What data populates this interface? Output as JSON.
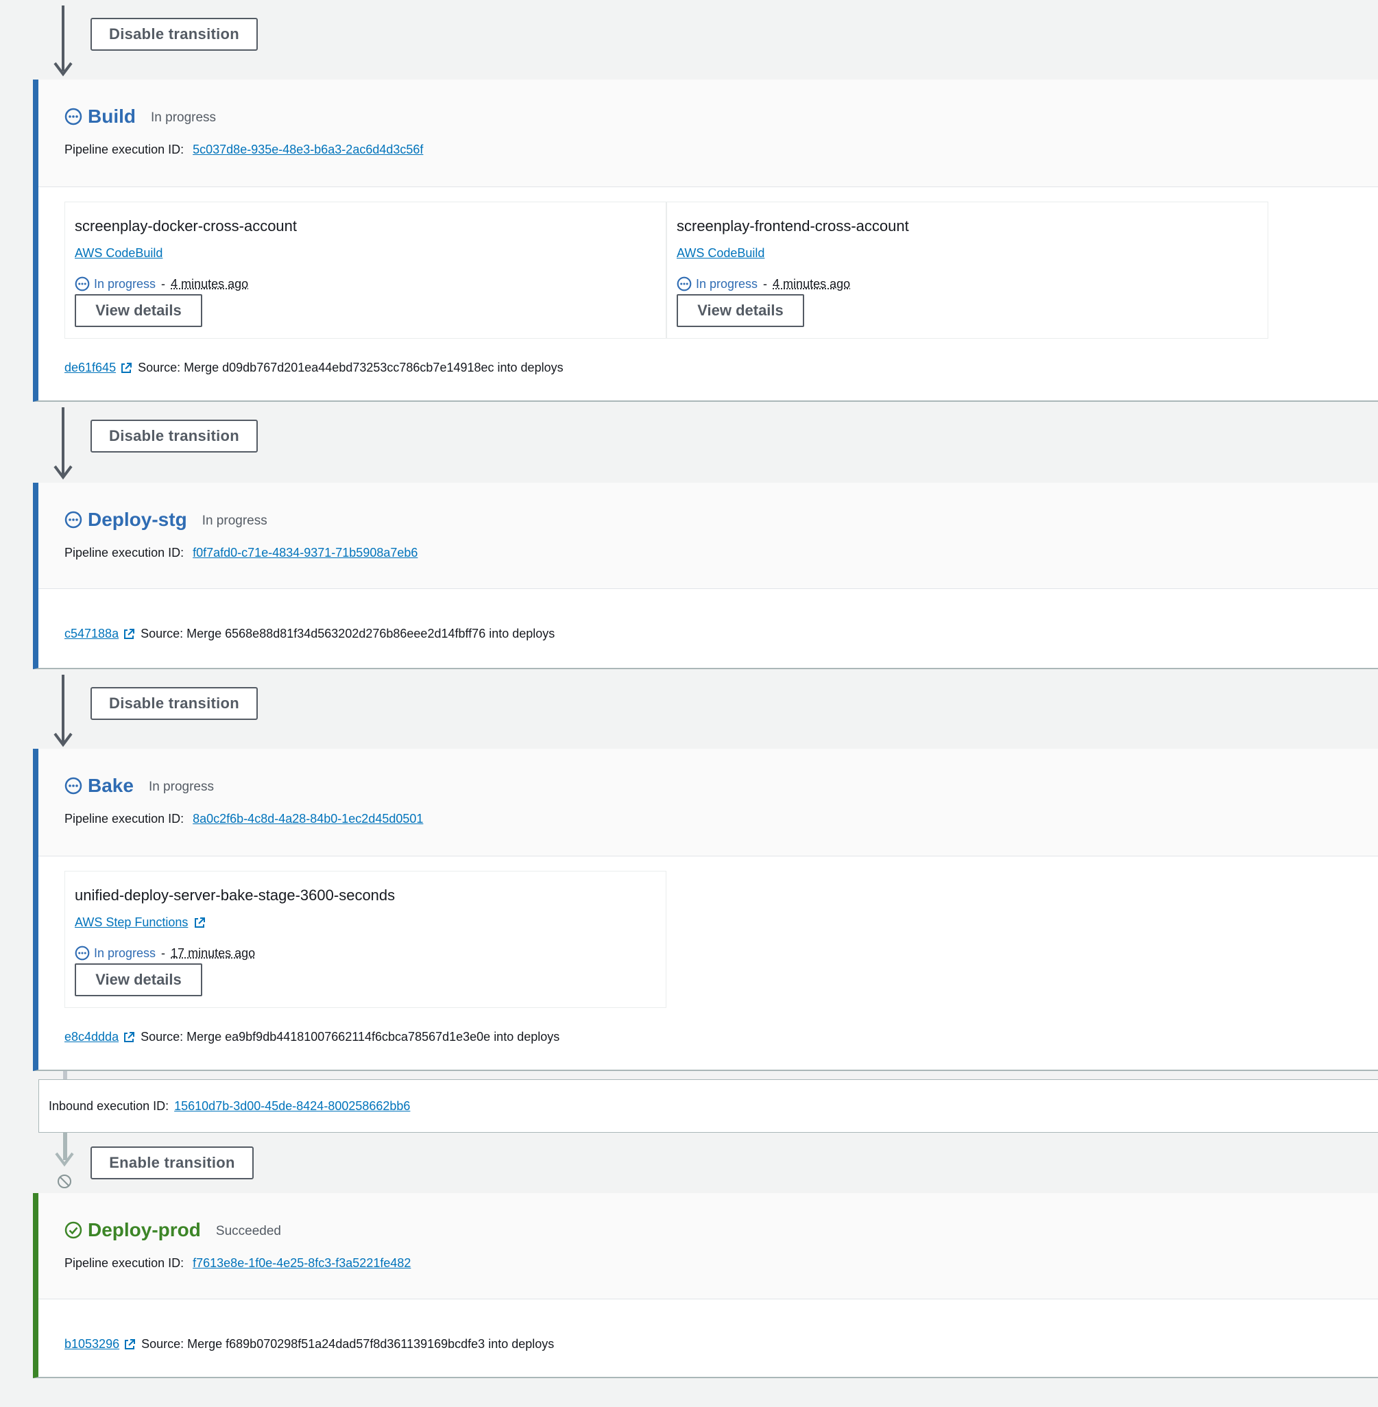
{
  "transitions": [
    {
      "label": "Disable transition"
    },
    {
      "label": "Disable transition"
    },
    {
      "label": "Disable transition"
    },
    {
      "label": "Enable transition"
    }
  ],
  "labels": {
    "pipeline_execution_id": "Pipeline execution ID:",
    "source_prefix": "Source:",
    "inbound_execution_id": "Inbound execution ID:",
    "view_details": "View details",
    "separator": "-"
  },
  "stages": [
    {
      "name": "Build",
      "status": "In progress",
      "execution_id": "5c037d8e-935e-48e3-b6a3-2ac6d4d3c56f",
      "actions": [
        {
          "name": "screenplay-docker-cross-account",
          "provider": "AWS CodeBuild",
          "status": "In progress",
          "time": "4 minutes ago"
        },
        {
          "name": "screenplay-frontend-cross-account",
          "provider": "AWS CodeBuild",
          "status": "In progress",
          "time": "4 minutes ago"
        }
      ],
      "revision": {
        "id": "de61f645",
        "summary": "Source: Merge d09db767d201ea44ebd73253cc786cb7e14918ec into deploys"
      }
    },
    {
      "name": "Deploy-stg",
      "status": "In progress",
      "execution_id": "f0f7afd0-c71e-4834-9371-71b5908a7eb6",
      "actions": [],
      "revision": {
        "id": "c547188a",
        "summary": "Source: Merge 6568e88d81f34d563202d276b86eee2d14fbff76 into deploys"
      }
    },
    {
      "name": "Bake",
      "status": "In progress",
      "execution_id": "8a0c2f6b-4c8d-4a28-84b0-1ec2d45d0501",
      "actions": [
        {
          "name": "unified-deploy-server-bake-stage-3600-seconds",
          "provider": "AWS Step Functions",
          "status": "In progress",
          "time": "17 minutes ago"
        }
      ],
      "revision": {
        "id": "e8c4ddda",
        "summary": "Source: Merge ea9bf9db44181007662114f6cbca78567d1e3e0e into deploys"
      }
    },
    {
      "name": "Deploy-prod",
      "status": "Succeeded",
      "execution_id": "f7613e8e-1f0e-4e25-8fc3-f3a5221fe482",
      "actions": [],
      "revision": {
        "id": "b1053296",
        "summary": "Source: Merge f689b070298f51a24dad57f8d361139169bcdfe3 into deploys"
      }
    }
  ],
  "inbound": {
    "execution_id": "15610d7b-3d00-45de-8424-800258662bb6"
  },
  "colors": {
    "accent": "#0073bb",
    "in_progress": "#2f6cb3",
    "success": "#3c8527",
    "text": "#16191f"
  }
}
